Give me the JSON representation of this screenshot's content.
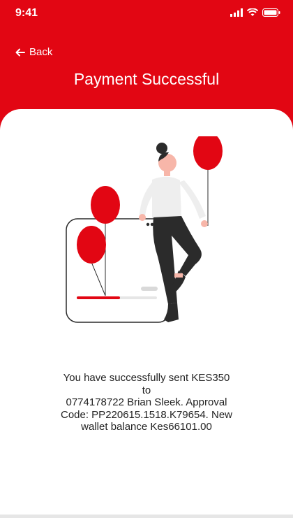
{
  "status_bar": {
    "time": "9:41",
    "icons": [
      "signal-icon",
      "wifi-icon",
      "battery-icon"
    ]
  },
  "header": {
    "back_label": "Back",
    "title": "Payment Successful"
  },
  "message": {
    "line1": "You have successfully sent KES350",
    "line2": "to",
    "line3": "0774178722 Brian Sleek. Approval",
    "line4": "Code: PP220615.1518.K79654. New",
    "line5": "wallet balance Kes66101.00"
  },
  "colors": {
    "brand": "#e20613",
    "background": "#ffffff"
  }
}
